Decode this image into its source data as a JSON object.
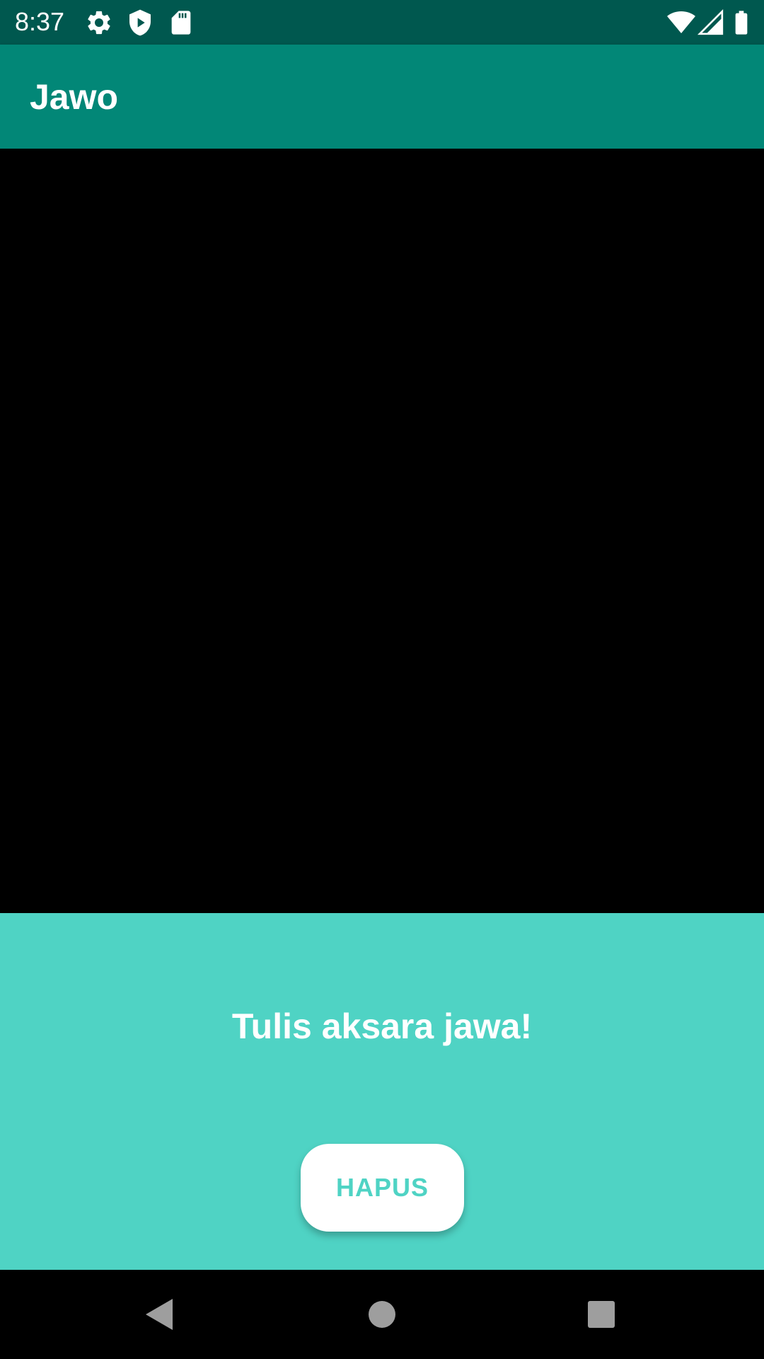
{
  "status_bar": {
    "time": "8:37",
    "left_icons": [
      "gear-icon",
      "shield-play-icon",
      "sd-card-icon"
    ],
    "right_icons": [
      "wifi-icon",
      "signal-icon",
      "battery-icon"
    ],
    "background_color": "#00584F"
  },
  "app_bar": {
    "title": "Jawo",
    "background_color": "#028777"
  },
  "canvas": {
    "background_color": "#000000"
  },
  "panel": {
    "prompt": "Tulis aksara jawa!",
    "clear_button_label": "HAPUS",
    "background_color": "#4FD3C4"
  },
  "nav_bar": {
    "buttons": [
      "back-icon",
      "home-icon",
      "recents-icon"
    ]
  }
}
